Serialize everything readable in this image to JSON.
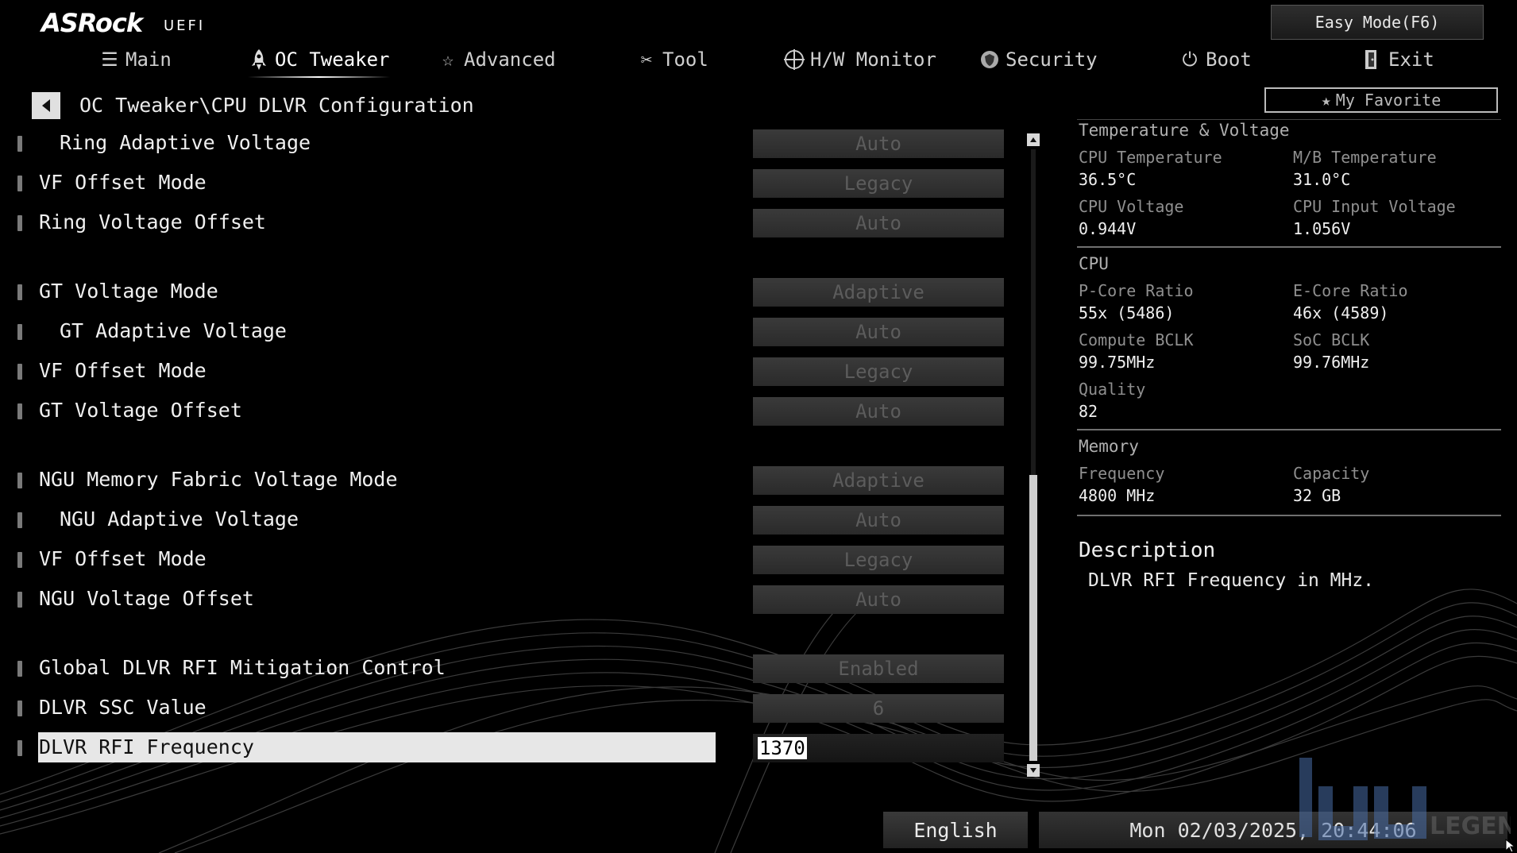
{
  "brand": {
    "name": "ASRock",
    "sub": "UEFI"
  },
  "header": {
    "easy_mode_label": "Easy Mode(F6)",
    "my_favorite_label": "My Favorite",
    "tabs": [
      {
        "label": "Main",
        "icon": "list-icon"
      },
      {
        "label": "OC Tweaker",
        "icon": "rocket-icon"
      },
      {
        "label": "Advanced",
        "icon": "star-icon"
      },
      {
        "label": "Tool",
        "icon": "wrench-icon"
      },
      {
        "label": "H/W Monitor",
        "icon": "crosshair-icon"
      },
      {
        "label": "Security",
        "icon": "shield-icon"
      },
      {
        "label": "Boot",
        "icon": "power-icon"
      },
      {
        "label": "Exit",
        "icon": "exit-icon"
      }
    ],
    "active_tab": "OC Tweaker"
  },
  "breadcrumb": "OC Tweaker\\CPU DLVR Configuration",
  "settings": [
    {
      "label": "Ring Adaptive Voltage",
      "value": "Auto"
    },
    {
      "label": "VF Offset Mode",
      "value": "Legacy"
    },
    {
      "label": "Ring Voltage Offset",
      "value": "Auto"
    },
    {
      "label": "GT Voltage Mode",
      "value": "Adaptive"
    },
    {
      "label": "GT Adaptive Voltage",
      "value": "Auto"
    },
    {
      "label": "VF Offset Mode",
      "value": "Legacy"
    },
    {
      "label": "GT Voltage Offset",
      "value": "Auto"
    },
    {
      "label": "NGU Memory Fabric Voltage Mode",
      "value": "Adaptive"
    },
    {
      "label": "NGU Adaptive Voltage",
      "value": "Auto"
    },
    {
      "label": "VF Offset Mode",
      "value": "Legacy"
    },
    {
      "label": "NGU Voltage Offset",
      "value": "Auto"
    },
    {
      "label": "Global DLVR RFI Mitigation Control",
      "value": "Enabled"
    },
    {
      "label": "DLVR SSC Value",
      "value": "6"
    },
    {
      "label": "DLVR RFI Frequency",
      "value": "1370"
    }
  ],
  "monitor": {
    "temp_voltage": {
      "title": "Temperature & Voltage",
      "cpu_temp_label": "CPU Temperature",
      "cpu_temp": "36.5°C",
      "mb_temp_label": "M/B Temperature",
      "mb_temp": "31.0°C",
      "cpu_voltage_label": "CPU Voltage",
      "cpu_voltage": "0.944V",
      "cpu_input_voltage_label": "CPU Input Voltage",
      "cpu_input_voltage": "1.056V"
    },
    "cpu": {
      "title": "CPU",
      "pcore_label": "P-Core Ratio",
      "pcore": "55x (5486)",
      "ecore_label": "E-Core Ratio",
      "ecore": "46x (4589)",
      "compute_bclk_label": "Compute BCLK",
      "compute_bclk": "99.75MHz",
      "soc_bclk_label": "SoC BCLK",
      "soc_bclk": "99.76MHz",
      "quality_label": "Quality",
      "quality": "82"
    },
    "memory": {
      "title": "Memory",
      "frequency_label": "Frequency",
      "frequency": "4800 MHz",
      "capacity_label": "Capacity",
      "capacity": "32 GB"
    }
  },
  "description": {
    "title": "Description",
    "text": "DLVR RFI Frequency in MHz."
  },
  "footer": {
    "language": "English",
    "datetime": "Mon 02/03/2025, 20:44:06"
  },
  "watermark": {
    "text": "LEGEND"
  },
  "colors": {
    "background": "#000000",
    "selected_row": "#e7e7e7",
    "value_box": "#333333"
  }
}
